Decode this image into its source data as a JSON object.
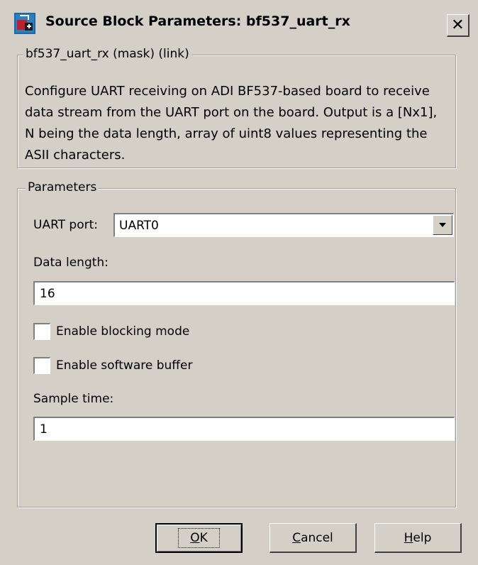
{
  "window": {
    "title": "Source Block Parameters: bf537_uart_rx",
    "close_label": "✕"
  },
  "mask": {
    "group_label": "bf537_uart_rx (mask) (link)",
    "description": "Configure UART receiving on ADI BF537-based board to receive data stream from the UART port on the board.  Output is a [Nx1], N being the data length, array of uint8 values representing the ASII characters."
  },
  "parameters": {
    "group_label": "Parameters",
    "uart_port_label": "UART port:",
    "uart_port_value": "UART0",
    "data_length_label": "Data length:",
    "data_length_value": "16",
    "blocking_mode_label": "Enable blocking mode",
    "blocking_mode_checked": false,
    "software_buffer_label": "Enable software buffer",
    "software_buffer_checked": false,
    "sample_time_label": "Sample time:",
    "sample_time_value": "1"
  },
  "buttons": {
    "ok_prefix": "O",
    "ok_rest": "K",
    "cancel_prefix": "C",
    "cancel_rest": "ancel",
    "help_prefix": "H",
    "help_rest": "elp"
  }
}
